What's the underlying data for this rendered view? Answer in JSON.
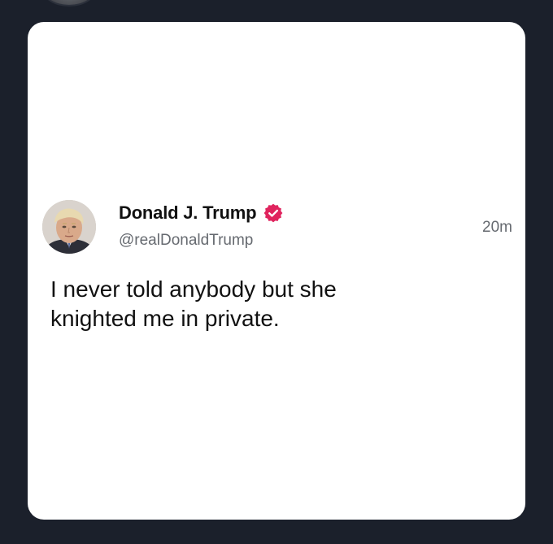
{
  "post": {
    "display_name": "Donald J. Trump",
    "handle": "@realDonaldTrump",
    "time": "20m",
    "text": "I never told anybody but she\nknighted me in private.",
    "verified_icon": "verified-badge-icon",
    "verified_color": "#e0245e"
  },
  "colors": {
    "background": "#1b202b",
    "card": "#ffffff"
  }
}
